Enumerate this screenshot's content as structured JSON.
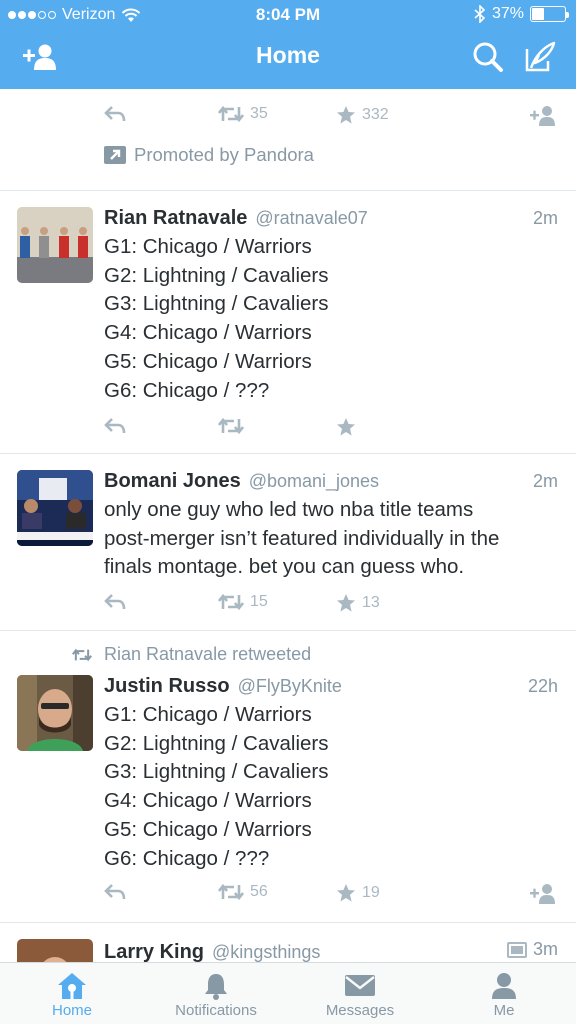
{
  "status_bar": {
    "carrier": "Verizon",
    "time": "8:04 PM",
    "battery": "37%",
    "battery_level": 0.37
  },
  "nav": {
    "title": "Home",
    "left_icon": "add-user-icon",
    "right_icons": [
      "search-icon",
      "compose-icon"
    ]
  },
  "promoted": {
    "retweets": "35",
    "favorites": "332",
    "promoted_label": "Promoted by Pandora"
  },
  "tweets": [
    {
      "name": "Rian Ratnavale",
      "handle": "@ratnavale07",
      "time": "2m",
      "lines": [
        "G1: Chicago / Warriors",
        "G2: Lightning / Cavaliers",
        "G3: Lightning / Cavaliers",
        "G4: Chicago / Warriors",
        "G5: Chicago / Warriors",
        "G6: Chicago / ???"
      ],
      "retweets": "",
      "favorites": ""
    },
    {
      "name": "Bomani Jones",
      "handle": "@bomani_jones",
      "time": "2m",
      "lines": [
        "only one guy who led two nba title teams",
        "post-merger isn’t featured individually in the",
        "finals montage. bet you can guess who."
      ],
      "retweets": "15",
      "favorites": "13"
    },
    {
      "retweeted_by": "Rian Ratnavale retweeted",
      "name": "Justin Russo",
      "handle": "@FlyByKnite",
      "time": "22h",
      "lines": [
        "G1: Chicago / Warriors",
        "G2: Lightning / Cavaliers",
        "G3: Lightning / Cavaliers",
        "G4: Chicago / Warriors",
        "G5: Chicago / Warriors",
        "G6: Chicago / ???"
      ],
      "retweets": "56",
      "favorites": "19"
    },
    {
      "name": "Larry King",
      "handle": "@kingsthings",
      "time": "3m"
    }
  ],
  "tabs": [
    {
      "label": "Home",
      "icon": "home-icon",
      "active": true
    },
    {
      "label": "Notifications",
      "icon": "bell-icon",
      "active": false
    },
    {
      "label": "Messages",
      "icon": "envelope-icon",
      "active": false
    },
    {
      "label": "Me",
      "icon": "person-icon",
      "active": false
    }
  ],
  "colors": {
    "brand": "#55acee",
    "text": "#292f33",
    "muted": "#8899a6",
    "icon_gray": "#aab8c2"
  }
}
